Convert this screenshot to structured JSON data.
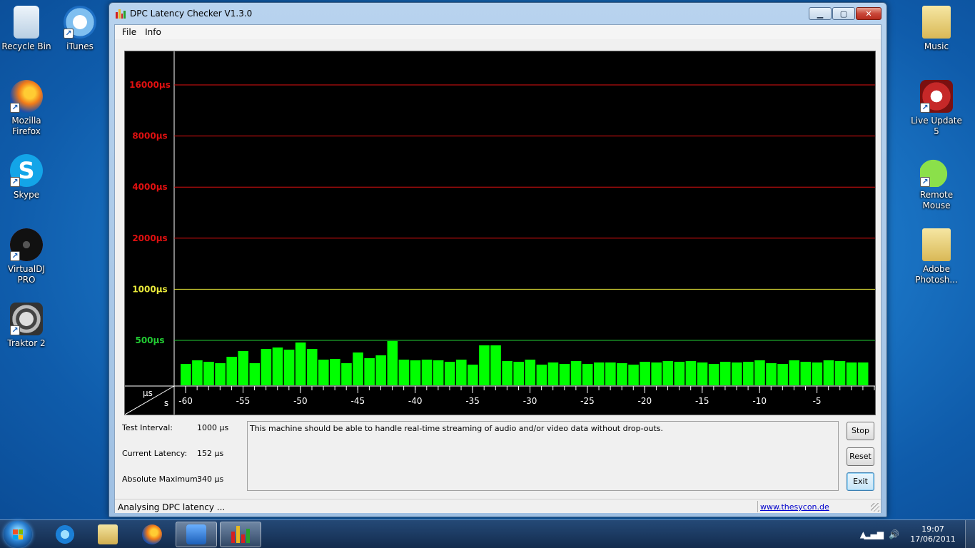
{
  "desktop": {
    "left_icons": [
      {
        "label": "Recycle Bin",
        "icon": "recycle-bin-icon"
      },
      {
        "label": "iTunes",
        "icon": "itunes-icon"
      },
      {
        "label": "Mozilla Firefox",
        "icon": "firefox-icon"
      },
      {
        "label": "Skype",
        "icon": "skype-icon"
      },
      {
        "label": "VirtualDJ PRO",
        "icon": "virtualdj-icon"
      },
      {
        "label": "Traktor 2",
        "icon": "traktor-icon"
      }
    ],
    "right_icons": [
      {
        "label": "Music",
        "icon": "folder-icon"
      },
      {
        "label": "Live Update 5",
        "icon": "live-update-icon"
      },
      {
        "label": "Remote Mouse",
        "icon": "remote-mouse-icon"
      },
      {
        "label": "Adobe Photosh...",
        "icon": "folder-icon"
      }
    ]
  },
  "window": {
    "title": "DPC Latency Checker V1.3.0",
    "menu": [
      "File",
      "Info"
    ],
    "stats": [
      {
        "label": "Test Interval:",
        "value": "1000 µs"
      },
      {
        "label": "Current Latency:",
        "value": "152 µs"
      },
      {
        "label": "Absolute Maximum:",
        "value": "340 µs"
      }
    ],
    "message": "This machine should be able to handle real-time streaming of audio and/or video data without drop-outs.",
    "buttons": {
      "stop": "Stop",
      "reset": "Reset",
      "exit": "Exit"
    },
    "status": "Analysing DPC latency ...",
    "link": "www.thesycon.de"
  },
  "chart_data": {
    "type": "bar",
    "x_unit_label": "s",
    "y_unit_label": "µs",
    "threshold_lines": [
      {
        "label": "16000µs",
        "value": 16000,
        "color": "#e01010"
      },
      {
        "label": "8000µs",
        "value": 8000,
        "color": "#e01010"
      },
      {
        "label": "4000µs",
        "value": 4000,
        "color": "#e01010"
      },
      {
        "label": "2000µs",
        "value": 2000,
        "color": "#e01010"
      },
      {
        "label": "1000µs",
        "value": 1000,
        "color": "#e8e83a"
      },
      {
        "label": "500µs",
        "value": 500,
        "color": "#22cc33"
      }
    ],
    "x_tick_labels": [
      "-60",
      "-55",
      "-50",
      "-45",
      "-40",
      "-35",
      "-30",
      "-25",
      "-20",
      "-15",
      "-10",
      "-5"
    ],
    "xlim": [
      -61,
      0
    ],
    "bar_color": "#00ff00",
    "x": [
      -60,
      -59,
      -58,
      -57,
      -56,
      -55,
      -54,
      -53,
      -52,
      -51,
      -50,
      -49,
      -48,
      -47,
      -46,
      -45,
      -44,
      -43,
      -42,
      -41,
      -40,
      -39,
      -38,
      -37,
      -36,
      -35,
      -34,
      -33,
      -32,
      -31,
      -30,
      -29,
      -28,
      -27,
      -26,
      -25,
      -24,
      -23,
      -22,
      -21,
      -20,
      -19,
      -18,
      -17,
      -16,
      -15,
      -14,
      -13,
      -12,
      -11,
      -10,
      -9,
      -8,
      -7,
      -6,
      -5,
      -4,
      -3,
      -2,
      -1
    ],
    "values": [
      150,
      175,
      165,
      155,
      200,
      240,
      155,
      255,
      265,
      250,
      300,
      255,
      180,
      185,
      155,
      230,
      190,
      210,
      310,
      180,
      175,
      180,
      175,
      165,
      180,
      145,
      280,
      280,
      170,
      165,
      180,
      145,
      160,
      150,
      170,
      150,
      160,
      160,
      155,
      145,
      165,
      160,
      170,
      165,
      170,
      160,
      150,
      165,
      160,
      165,
      175,
      155,
      150,
      175,
      165,
      160,
      175,
      170,
      160,
      160
    ]
  }
}
